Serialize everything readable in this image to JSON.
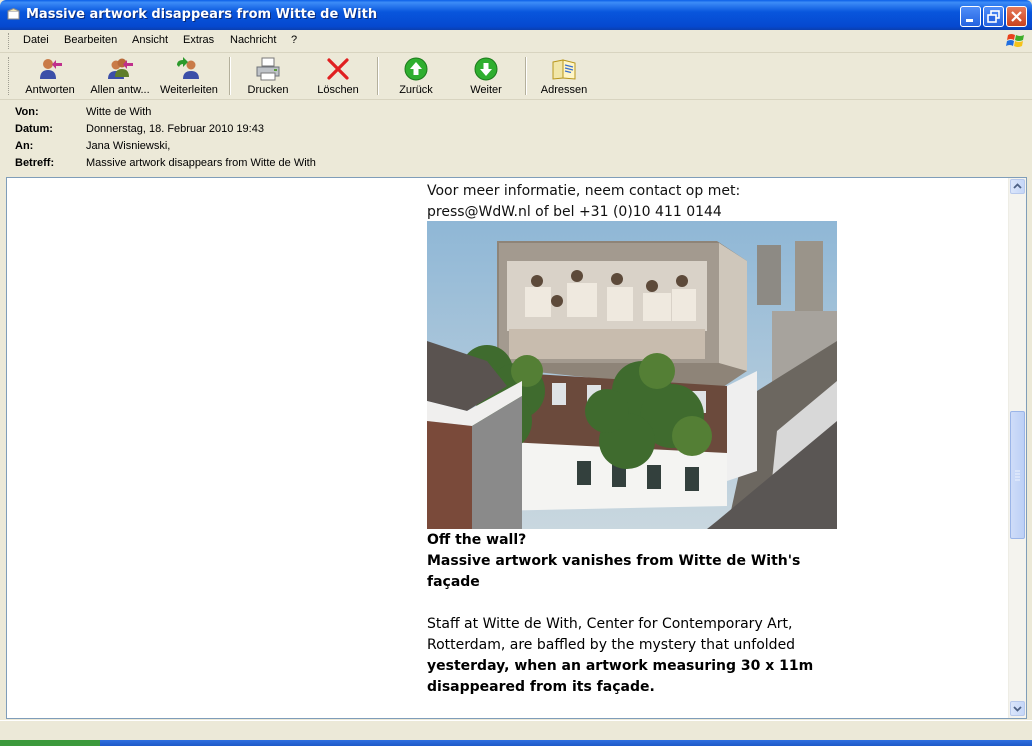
{
  "window": {
    "title": "Massive artwork disappears from Witte de With"
  },
  "menu": [
    "Datei",
    "Bearbeiten",
    "Ansicht",
    "Extras",
    "Nachricht",
    "?"
  ],
  "toolbar": [
    {
      "label": "Antworten",
      "icon": "reply-icon"
    },
    {
      "label": "Allen antw...",
      "icon": "reply-all-icon"
    },
    {
      "label": "Weiterleiten",
      "icon": "forward-icon"
    },
    {
      "label": "Drucken",
      "icon": "printer-icon"
    },
    {
      "label": "Löschen",
      "icon": "delete-icon"
    },
    {
      "label": "Zurück",
      "icon": "previous-icon"
    },
    {
      "label": "Weiter",
      "icon": "next-icon"
    },
    {
      "label": "Adressen",
      "icon": "address-book-icon"
    }
  ],
  "header": {
    "from_label": "Von:",
    "from": "Witte de With",
    "date_label": "Datum:",
    "date": "Donnerstag, 18. Februar 2010 19:43",
    "to_label": "An:",
    "to": "Jana Wisniewski,",
    "subject_label": "Betreff:",
    "subject": "Massive artwork disappears from Witte de With"
  },
  "body": {
    "contact_line1": "Voor meer informatie, neem contact op met:",
    "contact_line2": "press@WdW.nl of bel +31 (0)10 411 0144",
    "headline1": "Off the wall?",
    "headline2": "Massive artwork vanishes from Witte de With's",
    "headline3": "façade",
    "para_line1": "Staff at Witte de With, Center for Contemporary Art,",
    "para_line2": "Rotterdam, are baffled by the mystery that unfolded",
    "para_line3": "yesterday, when an artwork measuring 30 x 11m",
    "para_line4": "disappeared from its façade."
  },
  "colors": {
    "titlebar": "#0856dd",
    "chrome": "#ece9d8",
    "next_green": "#2fae2f",
    "delete_red": "#e02020"
  }
}
